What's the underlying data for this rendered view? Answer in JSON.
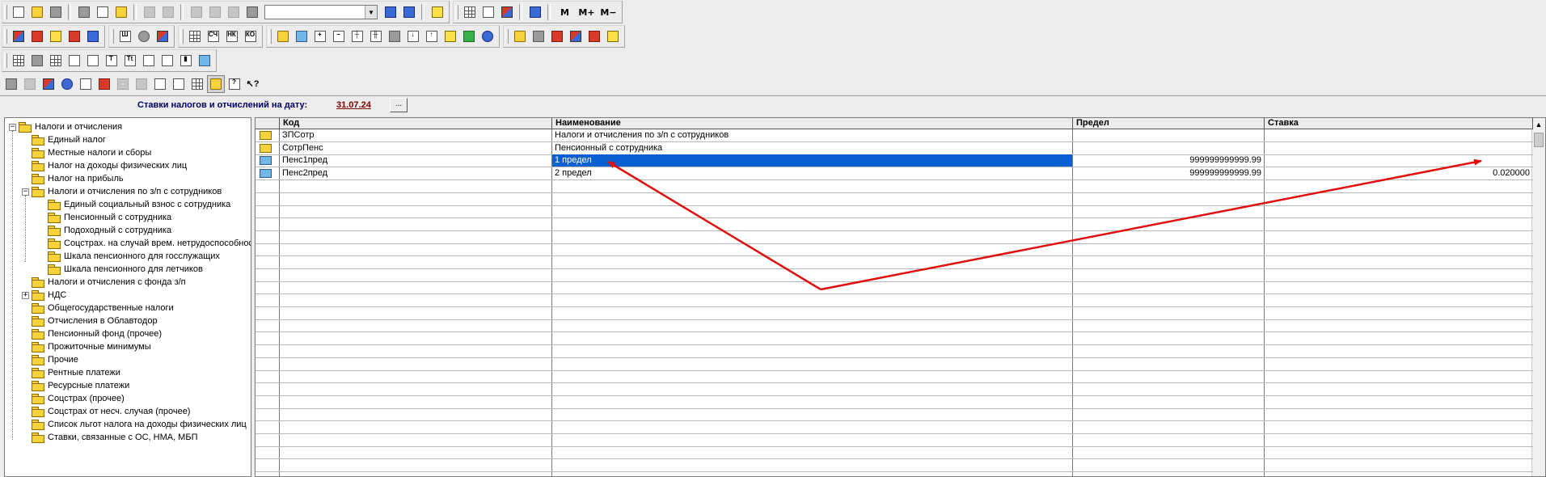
{
  "toolbar": {
    "row1": [
      {
        "name": "new-doc-icon"
      },
      {
        "name": "open-folder-icon"
      },
      {
        "name": "save-icon"
      },
      {
        "sep": true
      },
      {
        "name": "cut-icon"
      },
      {
        "name": "copy-icon"
      },
      {
        "name": "paste-icon"
      },
      {
        "sep": true
      },
      {
        "name": "print-icon",
        "disabled": true
      },
      {
        "name": "print-preview-icon",
        "disabled": true
      },
      {
        "sep": true
      },
      {
        "name": "calculator-icon",
        "disabled": true
      },
      {
        "name": "undo-icon",
        "disabled": true
      },
      {
        "name": "redo-icon",
        "disabled": true
      },
      {
        "name": "binoculars-icon"
      },
      {
        "combo": true
      },
      {
        "name": "find-next-icon"
      },
      {
        "name": "find-replace-icon"
      },
      {
        "sep": true
      },
      {
        "name": "help-icon"
      }
    ],
    "row1b": [
      {
        "name": "calc-keyboard-icon"
      },
      {
        "name": "calendar-icon"
      },
      {
        "name": "chat-icon"
      },
      {
        "sep": true
      },
      {
        "name": "book-icon"
      },
      {
        "sep": true
      },
      {
        "text": "M",
        "name": "memory-button"
      },
      {
        "text": "M+",
        "name": "memory-plus-button"
      },
      {
        "text": "M−",
        "name": "memory-minus-button"
      }
    ]
  },
  "datebar": {
    "label": "Ставки налогов и отчислений на дату:",
    "date": "31.07.24",
    "button_label": "..."
  },
  "tree": {
    "items": [
      {
        "label": "Налоги и отчисления",
        "level": 0,
        "expander": "−"
      },
      {
        "label": "Единый налог",
        "level": 1
      },
      {
        "label": "Местные налоги и сборы",
        "level": 1
      },
      {
        "label": "Налог на доходы физических лиц",
        "level": 1
      },
      {
        "label": "Налог на прибыль",
        "level": 1
      },
      {
        "label": "Налоги и отчисления по з/п с сотрудников",
        "level": 1,
        "expander": "−"
      },
      {
        "label": "Единый социальный взнос с сотрудника",
        "level": 2
      },
      {
        "label": "Пенсионный с сотрудника",
        "level": 2,
        "open": true
      },
      {
        "label": "Подоходный с сотрудника",
        "level": 2
      },
      {
        "label": "Соцстрах. на случай врем. нетрудоспособности",
        "level": 2
      },
      {
        "label": "Шкала пенсионного для госслужащих",
        "level": 2
      },
      {
        "label": "Шкала пенсионного для летчиков",
        "level": 2
      },
      {
        "label": "Налоги и отчисления с фонда з/п",
        "level": 1
      },
      {
        "label": "НДС",
        "level": 1,
        "expander": "+"
      },
      {
        "label": "Общегосударственные налоги",
        "level": 1
      },
      {
        "label": "Отчисления в Облавтодор",
        "level": 1
      },
      {
        "label": "Пенсионный фонд (прочее)",
        "level": 1
      },
      {
        "label": "Прожиточные минимумы",
        "level": 1
      },
      {
        "label": "Прочие",
        "level": 1
      },
      {
        "label": "Рентные платежи",
        "level": 1
      },
      {
        "label": "Ресурсные платежи",
        "level": 1
      },
      {
        "label": "Соцстрах (прочее)",
        "level": 1
      },
      {
        "label": "Соцстрах от несч. случая (прочее)",
        "level": 1
      },
      {
        "label": "Список льгот налога на доходы физических лиц",
        "level": 1
      },
      {
        "label": "Ставки, связанные с ОС, НМА, МБП",
        "level": 1
      }
    ]
  },
  "grid": {
    "columns": [
      {
        "label": "Код"
      },
      {
        "label": "Наименование"
      },
      {
        "label": "Предел"
      },
      {
        "label": "Ставка"
      }
    ],
    "rows": [
      {
        "icon": "folder",
        "code": "ЗПСотр",
        "name": "Налоги и отчисления по з/п с сотрудников",
        "limit": "",
        "rate": ""
      },
      {
        "icon": "folder-open",
        "code": "СотрПенс",
        "name": "Пенсионный с сотрудника",
        "limit": "",
        "rate": ""
      },
      {
        "icon": "item",
        "code": "Пенс1пред",
        "name": "1 предел",
        "limit": "999999999999.99",
        "rate": "",
        "selected": true
      },
      {
        "icon": "item",
        "code": "Пенс2пред",
        "name": "2 предел",
        "limit": "999999999999.99",
        "rate": "0.020000"
      }
    ]
  },
  "colors": {
    "selection": "#0a5fd1",
    "arrow": "#e01010",
    "date": "#7a0000",
    "label": "#000064"
  }
}
